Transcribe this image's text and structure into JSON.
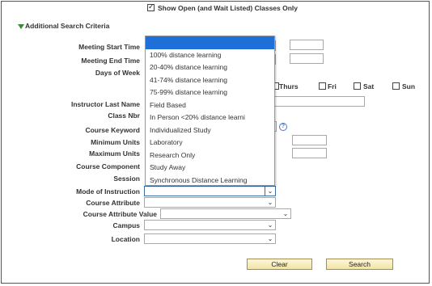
{
  "show_open": {
    "label": "Show Open (and Wait Listed) Classes Only",
    "checked": true
  },
  "section_title": "Additional Search Criteria",
  "labels": {
    "meeting_start": "Meeting Start Time",
    "meeting_end": "Meeting End Time",
    "days_of_week": "Days of Week",
    "instructor_last": "Instructor Last Name",
    "class_nbr": "Class Nbr",
    "course_keyword": "Course Keyword",
    "min_units": "Minimum Units",
    "max_units": "Maximum Units",
    "course_component": "Course Component",
    "session": "Session",
    "mode_of_instruction": "Mode of Instruction",
    "course_attribute": "Course Attribute",
    "course_attribute_value": "Course Attribute Value",
    "campus": "Campus",
    "location": "Location"
  },
  "days": {
    "thurs": "Thurs",
    "fri": "Fri",
    "sat": "Sat",
    "sun": "Sun"
  },
  "dropdown_options": [
    "",
    "100% distance learning",
    "20-40% distance learning",
    "41-74% distance learning",
    "75-99% distance learning",
    "Field Based",
    "In Person <20% distance learni",
    "Individualized Study",
    "Laboratory",
    "Research Only",
    "Study Away",
    "Synchronous Distance Learning"
  ],
  "buttons": {
    "clear": "Clear",
    "search": "Search"
  },
  "colors": {
    "highlight": "#1e6fd8",
    "button_bg": "#f2e3a6",
    "tri": "#3a8a3a"
  }
}
